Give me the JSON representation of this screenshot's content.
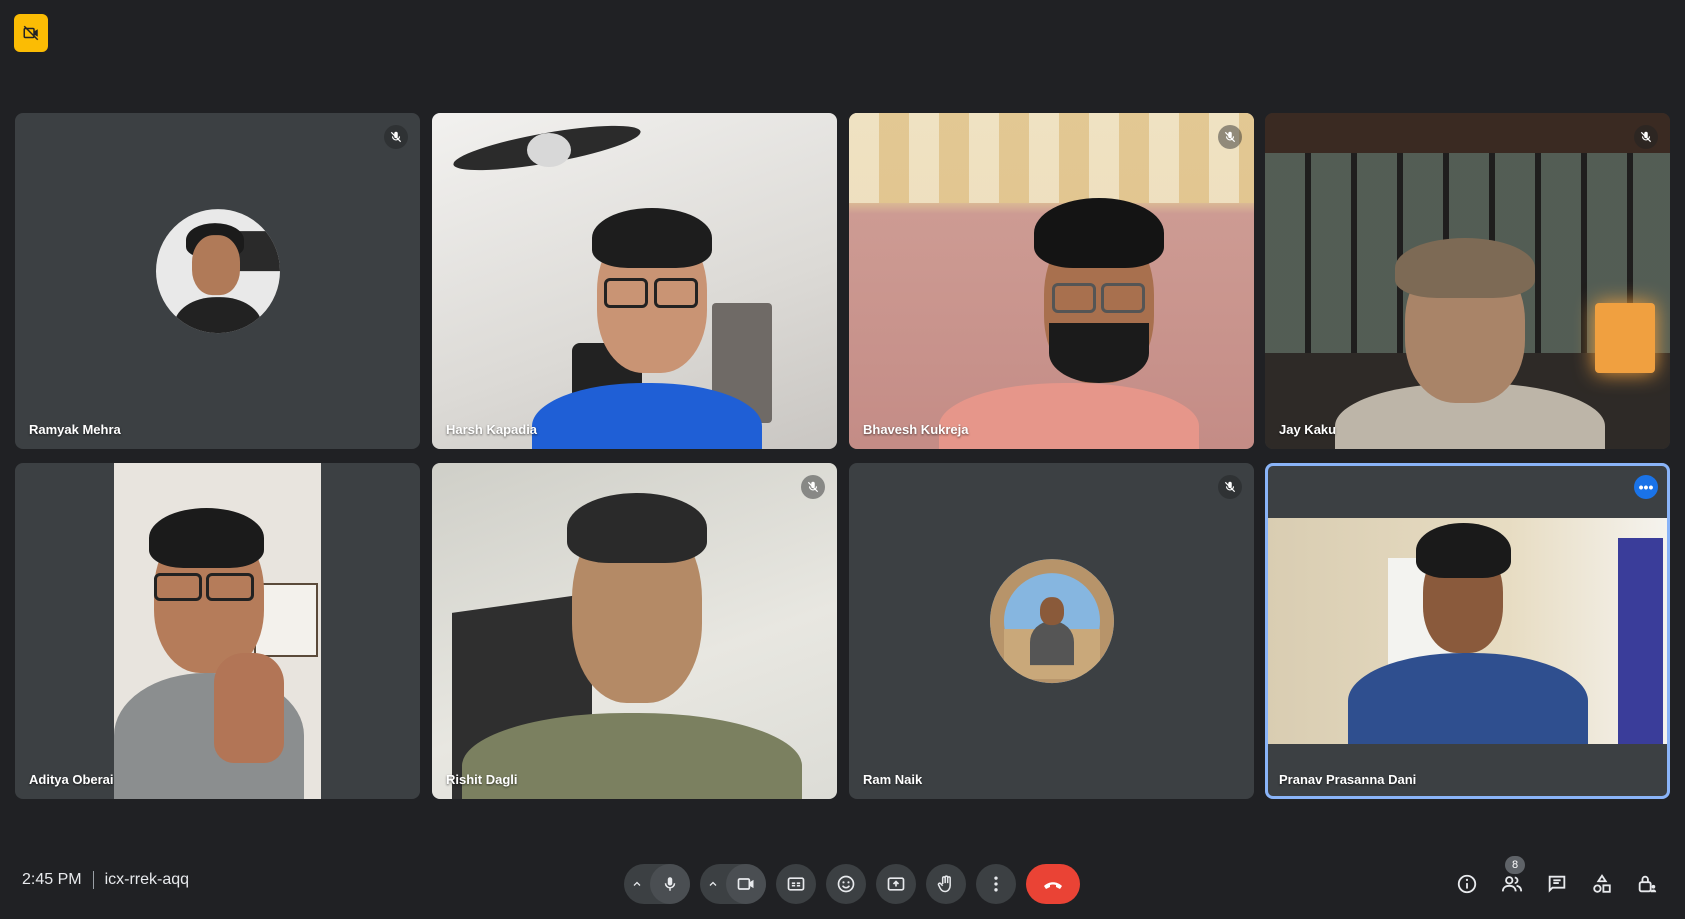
{
  "meeting": {
    "time": "2:45 PM",
    "code": "icx-rrek-aqq",
    "participant_count": "8"
  },
  "participants": [
    {
      "name": "Ramyak Mehra",
      "muted": true,
      "video": false
    },
    {
      "name": "Harsh Kapadia",
      "muted": false,
      "video": true
    },
    {
      "name": "Bhavesh Kukreja",
      "muted": true,
      "video": true
    },
    {
      "name": "Jay Kaku",
      "muted": true,
      "video": true
    },
    {
      "name": "Aditya Oberai",
      "muted": false,
      "video": true
    },
    {
      "name": "Rishit Dagli",
      "muted": true,
      "video": true
    },
    {
      "name": "Ram Naik",
      "muted": true,
      "video": false
    },
    {
      "name": "Pranav Prasanna Dani",
      "muted": false,
      "video": true,
      "selected": true
    }
  ],
  "controls": {
    "mic": "mic-icon",
    "camera": "camera-icon",
    "captions": "captions-icon",
    "reactions": "emoji-icon",
    "present": "present-screen-icon",
    "raise_hand": "hand-icon",
    "more_options": "more-vert-icon",
    "leave": "hangup-icon"
  },
  "colors": {
    "background": "#202124",
    "tile": "#3c4043",
    "accent": "#8ab4f8",
    "hangup": "#ea4335",
    "badge": "#fbbc04"
  }
}
